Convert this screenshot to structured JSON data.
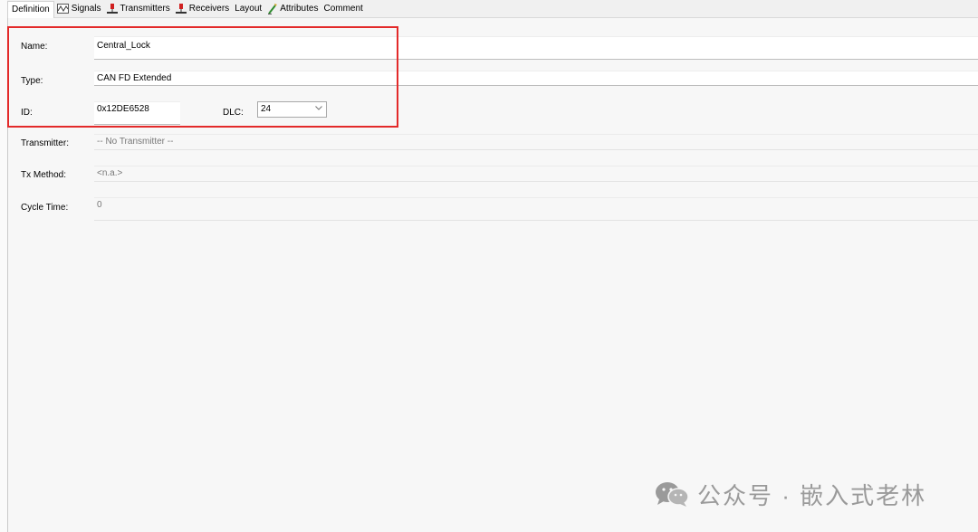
{
  "tabs": [
    {
      "label": "Definition",
      "icon": "none",
      "active": true
    },
    {
      "label": "Signals",
      "icon": "signals-icon"
    },
    {
      "label": "Transmitters",
      "icon": "transmitter-icon"
    },
    {
      "label": "Receivers",
      "icon": "receiver-icon"
    },
    {
      "label": "Layout",
      "icon": "none"
    },
    {
      "label": "Attributes",
      "icon": "attributes-icon"
    },
    {
      "label": "Comment",
      "icon": "none"
    }
  ],
  "form": {
    "name_label": "Name:",
    "name_value": "Central_Lock",
    "type_label": "Type:",
    "type_value": "CAN FD Extended",
    "id_label": "ID:",
    "id_value": "0x12DE6528",
    "dlc_label": "DLC:",
    "dlc_value": "24",
    "transmitter_label": "Transmitter:",
    "transmitter_value": "-- No Transmitter --",
    "txmethod_label": "Tx Method:",
    "txmethod_value": "<n.a.>",
    "cycletime_label": "Cycle Time:",
    "cycletime_value": "0"
  },
  "watermark": {
    "text": "公众号 · 嵌入式老林",
    "icon": "wechat-icon"
  },
  "colors": {
    "highlight_box": "#e32a2a",
    "background": "#f7f7f7"
  }
}
